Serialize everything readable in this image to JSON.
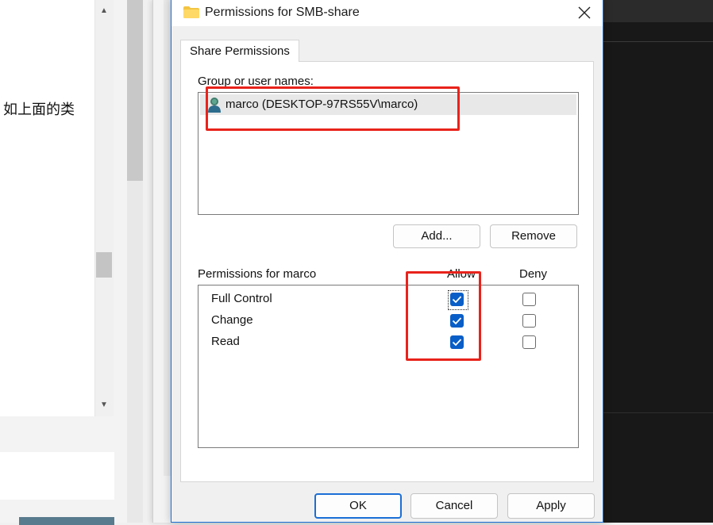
{
  "background": {
    "left_page_text": "如上面的类"
  },
  "dialog": {
    "title": "Permissions for SMB-share",
    "tab_label": "Share Permissions",
    "group_label": "Group or user names:",
    "users": [
      {
        "name": "marco (DESKTOP-97RS55V\\marco)",
        "selected": true
      }
    ],
    "add_button": "Add...",
    "remove_button": "Remove",
    "permissions_label": "Permissions for marco",
    "allow_header": "Allow",
    "deny_header": "Deny",
    "permissions": [
      {
        "name": "Full Control",
        "allow": true,
        "deny": false
      },
      {
        "name": "Change",
        "allow": true,
        "deny": false
      },
      {
        "name": "Read",
        "allow": true,
        "deny": false
      }
    ],
    "ok_button": "OK",
    "cancel_button": "Cancel",
    "apply_button": "Apply"
  },
  "colors": {
    "accent": "#0a5ec7",
    "annotation": "#e8231b"
  }
}
